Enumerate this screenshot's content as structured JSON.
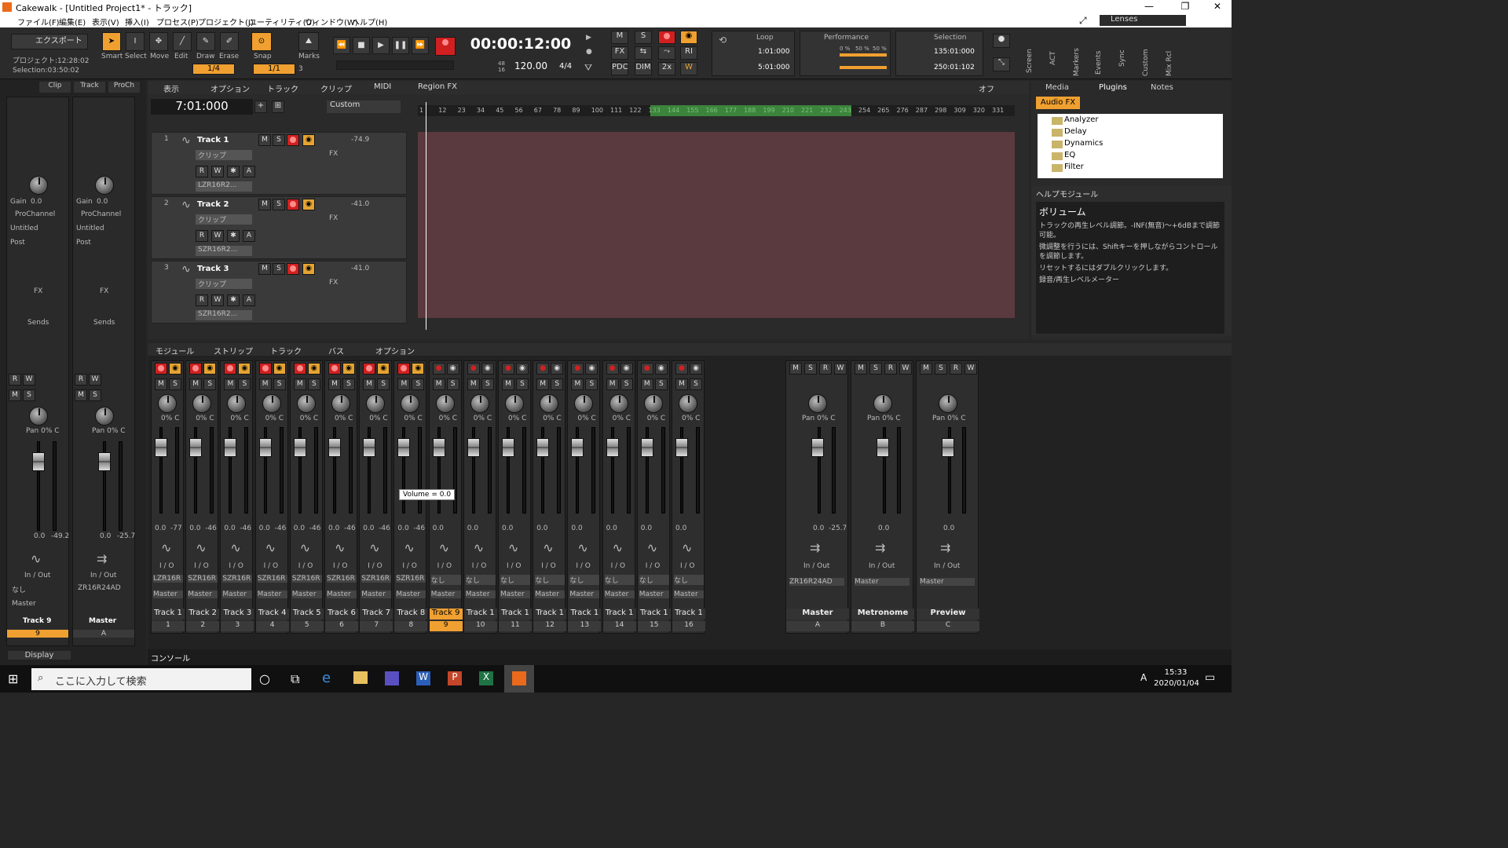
{
  "window": {
    "title": "Cakewalk - [Untitled Project1* - トラック]",
    "minimize": "—",
    "maximize": "❐",
    "close": "✕"
  },
  "menu": [
    "ファイル(F)",
    "編集(E)",
    "表示(V)",
    "挿入(I)",
    "プロセス(P)",
    "プロジェクト(J)",
    "ユーティリティ(U)",
    "ウィンドウ(W)",
    "ヘルプ(H)"
  ],
  "lenses": "Lenses",
  "control": {
    "export": "エクスポート",
    "project_time": "プロジェクト:12:28:02",
    "selection_time": "Selection:03:50:02",
    "tools": [
      "Smart",
      "Select",
      "Move",
      "Edit",
      "Draw",
      "Erase"
    ],
    "snap": "Snap",
    "marks": "Marks",
    "snap_val": "1/4",
    "snap_val2": "1/1",
    "snap_num": "3",
    "time": "00:00:12:00",
    "tempo": "120.00",
    "meter": "4/4",
    "meter_top": "48",
    "meter_bot": "16",
    "mix_btns": [
      "M",
      "S",
      "FX",
      "PDC",
      "DIM",
      "2x",
      "RI"
    ],
    "loop": {
      "title": "Loop",
      "start": "1:01:000",
      "end": "5:01:000"
    },
    "performance": {
      "title": "Performance",
      "v1": "0 %",
      "v2": "50 %",
      "v3": "50 %"
    },
    "selection": {
      "title": "Selection",
      "start": "135:01:000",
      "end": "250:01:102"
    },
    "right_tabs": [
      "Screen",
      "ACT",
      "Markers",
      "Events",
      "Sync",
      "Custom",
      "Mix Rcl"
    ]
  },
  "inspector": {
    "tabs": [
      "Clip",
      "Track",
      "ProCh"
    ],
    "strips": [
      {
        "gain_label": "Gain",
        "gain": "0.0",
        "pan_label": "Pan",
        "pan": "C",
        "pc": "ProChannel",
        "preset": "Untitled",
        "post": "Post",
        "fx": "FX",
        "sends": "Sends",
        "pan_text": "Pan 0% C",
        "vol": "0.0",
        "peak": "-49.2",
        "io": "In / Out",
        "in": "なし",
        "out": "Master",
        "name": "Track 9",
        "num": "9"
      },
      {
        "gain_label": "Gain",
        "gain": "0.0",
        "pan_label": "Pan",
        "pan": "C",
        "pc": "ProChannel",
        "preset": "Untitled",
        "post": "Post",
        "fx": "FX",
        "sends": "Sends",
        "pan_text": "Pan 0% C",
        "vol": "0.0",
        "peak": "-25.7",
        "io": "In / Out",
        "in": "ZR16R24AD",
        "out": "",
        "name": "Master",
        "num": "A"
      }
    ],
    "display": "Display"
  },
  "trackview": {
    "menus": [
      "表示",
      "オプション",
      "トラック",
      "クリップ",
      "MIDI",
      "Region FX"
    ],
    "now": "7:01:000",
    "zoom": "Custom",
    "off": "オフ",
    "ruler": [
      "1",
      "12",
      "23",
      "34",
      "45",
      "56",
      "67",
      "78",
      "89",
      "100",
      "111",
      "122",
      "133",
      "144",
      "155",
      "166",
      "177",
      "188",
      "199",
      "210",
      "221",
      "232",
      "243",
      "254",
      "265",
      "276",
      "287",
      "298",
      "309",
      "320",
      "331"
    ],
    "tracks": [
      {
        "num": "1",
        "name": "Track 1",
        "vol": "-74.9",
        "clip": "クリップ",
        "input": "LZR16R2...",
        "fx": "FX"
      },
      {
        "num": "2",
        "name": "Track 2",
        "vol": "-41.0",
        "clip": "クリップ",
        "input": "SZR16R2...",
        "fx": "FX"
      },
      {
        "num": "3",
        "name": "Track 3",
        "vol": "-41.0",
        "clip": "クリップ",
        "input": "SZR16R2...",
        "fx": "FX"
      }
    ]
  },
  "browser": {
    "tabs": [
      "Media",
      "Plugins",
      "Notes"
    ],
    "audiofx": "Audio FX",
    "folders": [
      "Analyzer",
      "Delay",
      "Dynamics",
      "EQ",
      "Filter"
    ]
  },
  "help": {
    "title": "ヘルプモジュール",
    "heading": "ボリューム",
    "lines": [
      "トラックの再生レベル調節。-INF(無音)〜+6dBまで調節可能。",
      "微調整を行うには、Shiftキーを押しながらコントロールを調節します。",
      "リセットするにはダブルクリックします。",
      "録音/再生レベルメーター"
    ]
  },
  "console": {
    "menus": [
      "モジュール",
      "ストリップ",
      "トラック",
      "バス",
      "オプション"
    ],
    "tooltip": "Volume = 0.0",
    "channels": [
      {
        "name": "Track 1",
        "num": "1",
        "in": "LZR16R",
        "vol": "0.0",
        "peak": "-77",
        "pan": "0% C",
        "rec": true
      },
      {
        "name": "Track 2",
        "num": "2",
        "in": "SZR16R",
        "vol": "0.0",
        "peak": "-46",
        "pan": "0% C",
        "rec": true
      },
      {
        "name": "Track 3",
        "num": "3",
        "in": "SZR16R",
        "vol": "0.0",
        "peak": "-46",
        "pan": "0% C",
        "rec": true
      },
      {
        "name": "Track 4",
        "num": "4",
        "in": "SZR16R",
        "vol": "0.0",
        "peak": "-46",
        "pan": "0% C",
        "rec": true
      },
      {
        "name": "Track 5",
        "num": "5",
        "in": "SZR16R",
        "vol": "0.0",
        "peak": "-46",
        "pan": "0% C",
        "rec": true
      },
      {
        "name": "Track 6",
        "num": "6",
        "in": "SZR16R",
        "vol": "0.0",
        "peak": "-46",
        "pan": "0% C",
        "rec": true
      },
      {
        "name": "Track 7",
        "num": "7",
        "in": "SZR16R",
        "vol": "0.0",
        "peak": "-46",
        "pan": "0% C",
        "rec": true
      },
      {
        "name": "Track 8",
        "num": "8",
        "in": "SZR16R",
        "vol": "0.0",
        "peak": "-46",
        "pan": "0% C",
        "rec": true
      },
      {
        "name": "Track 9",
        "num": "9",
        "in": "なし",
        "vol": "0.0",
        "peak": "",
        "pan": "0% C",
        "rec": false
      },
      {
        "name": "Track 1",
        "num": "10",
        "in": "なし",
        "vol": "0.0",
        "peak": "",
        "pan": "0% C",
        "rec": false
      },
      {
        "name": "Track 1",
        "num": "11",
        "in": "なし",
        "vol": "0.0",
        "peak": "",
        "pan": "0% C",
        "rec": false
      },
      {
        "name": "Track 1",
        "num": "12",
        "in": "なし",
        "vol": "0.0",
        "peak": "",
        "pan": "0% C",
        "rec": false
      },
      {
        "name": "Track 1",
        "num": "13",
        "in": "なし",
        "vol": "0.0",
        "peak": "",
        "pan": "0% C",
        "rec": false
      },
      {
        "name": "Track 1",
        "num": "14",
        "in": "なし",
        "vol": "0.0",
        "peak": "",
        "pan": "0% C",
        "rec": false
      },
      {
        "name": "Track 1",
        "num": "15",
        "in": "なし",
        "vol": "0.0",
        "peak": "",
        "pan": "0% C",
        "rec": false
      },
      {
        "name": "Track 1",
        "num": "16",
        "in": "なし",
        "vol": "0.0",
        "peak": "",
        "pan": "0% C",
        "rec": false
      }
    ],
    "out": "Master",
    "io": "I / O",
    "buses": [
      {
        "name": "Master",
        "num": "A",
        "out": "ZR16R24AD",
        "vol": "0.0",
        "peak": "-25.7",
        "pan": "Pan 0% C",
        "io": "In / Out"
      },
      {
        "name": "Metronome",
        "num": "B",
        "out": "Master",
        "vol": "0.0",
        "peak": "",
        "pan": "Pan 0% C",
        "io": "In / Out"
      },
      {
        "name": "Preview",
        "num": "C",
        "out": "Master",
        "vol": "0.0",
        "peak": "",
        "pan": "Pan 0% C",
        "io": "In / Out"
      }
    ],
    "tab": "コンソール"
  },
  "taskbar": {
    "search": "ここに入力して検索",
    "time": "15:33",
    "date": "2020/01/04",
    "ime": "A"
  },
  "colors": {
    "accent": "#f0a030",
    "rec": "#d02020",
    "clip_bg": "#5b3a3f"
  }
}
